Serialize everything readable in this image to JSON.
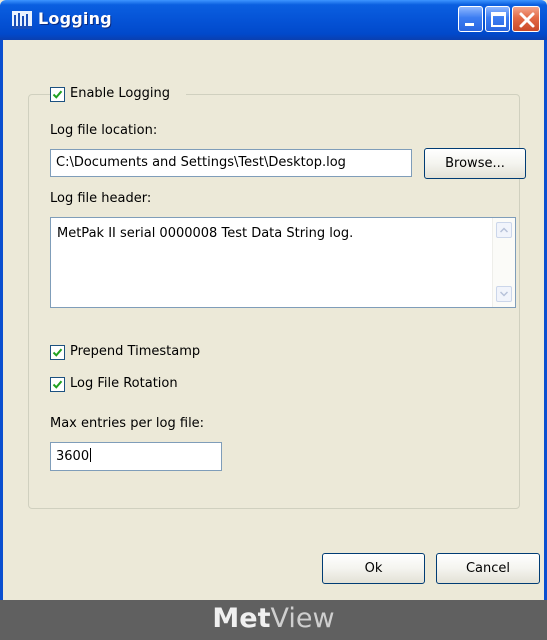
{
  "window": {
    "title": "Logging"
  },
  "enable_logging": {
    "label": "Enable Logging",
    "checked": true
  },
  "log_file_location": {
    "label": "Log file location:",
    "value": "C:\\Documents and Settings\\Test\\Desktop.log",
    "browse_label": "Browse..."
  },
  "log_file_header": {
    "label": "Log file header:",
    "value": "MetPak II serial 0000008 Test Data String log."
  },
  "prepend_timestamp": {
    "label": "Prepend Timestamp",
    "checked": true
  },
  "log_file_rotation": {
    "label": "Log File Rotation",
    "checked": true
  },
  "max_entries": {
    "label": "Max entries per log file:",
    "value": "3600"
  },
  "buttons": {
    "ok": "Ok",
    "cancel": "Cancel"
  },
  "brand": {
    "part1": "Met",
    "part2": "View"
  },
  "colors": {
    "title_bar": "#0553d6",
    "dialog_bg": "#ece9d8",
    "footer_bg": "#606060",
    "check": "#21a121"
  }
}
